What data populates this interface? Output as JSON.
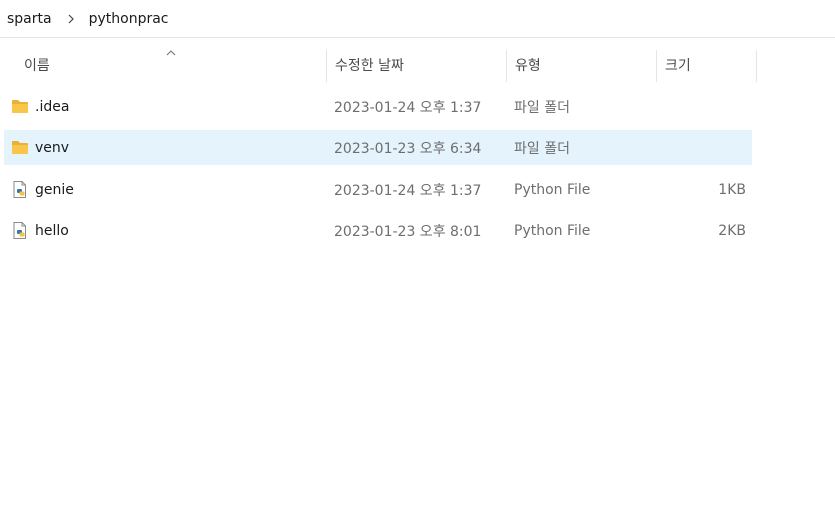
{
  "breadcrumb": {
    "items": [
      "sparta",
      "pythonprac"
    ]
  },
  "columns": {
    "name": "이름",
    "date": "수정한 날짜",
    "type": "유형",
    "size": "크기",
    "sort_indicator_icon": "chevron-up-icon"
  },
  "files": [
    {
      "name": ".idea",
      "date": "2023-01-24 오후 1:37",
      "type": "파일 폴더",
      "size": "",
      "icon": "folder-icon",
      "selected": false
    },
    {
      "name": "venv",
      "date": "2023-01-23 오후 6:34",
      "type": "파일 폴더",
      "size": "",
      "icon": "folder-icon",
      "selected": true
    },
    {
      "name": "genie",
      "date": "2023-01-24 오후 1:37",
      "type": "Python File",
      "size": "1KB",
      "icon": "python-file-icon",
      "selected": false
    },
    {
      "name": "hello",
      "date": "2023-01-23 오후 8:01",
      "type": "Python File",
      "size": "2KB",
      "icon": "python-file-icon",
      "selected": false
    }
  ],
  "colors": {
    "selection_bg": "#e5f3fc",
    "folder_yellow": "#f8c74a",
    "secondary_text": "#6e6e6e"
  }
}
